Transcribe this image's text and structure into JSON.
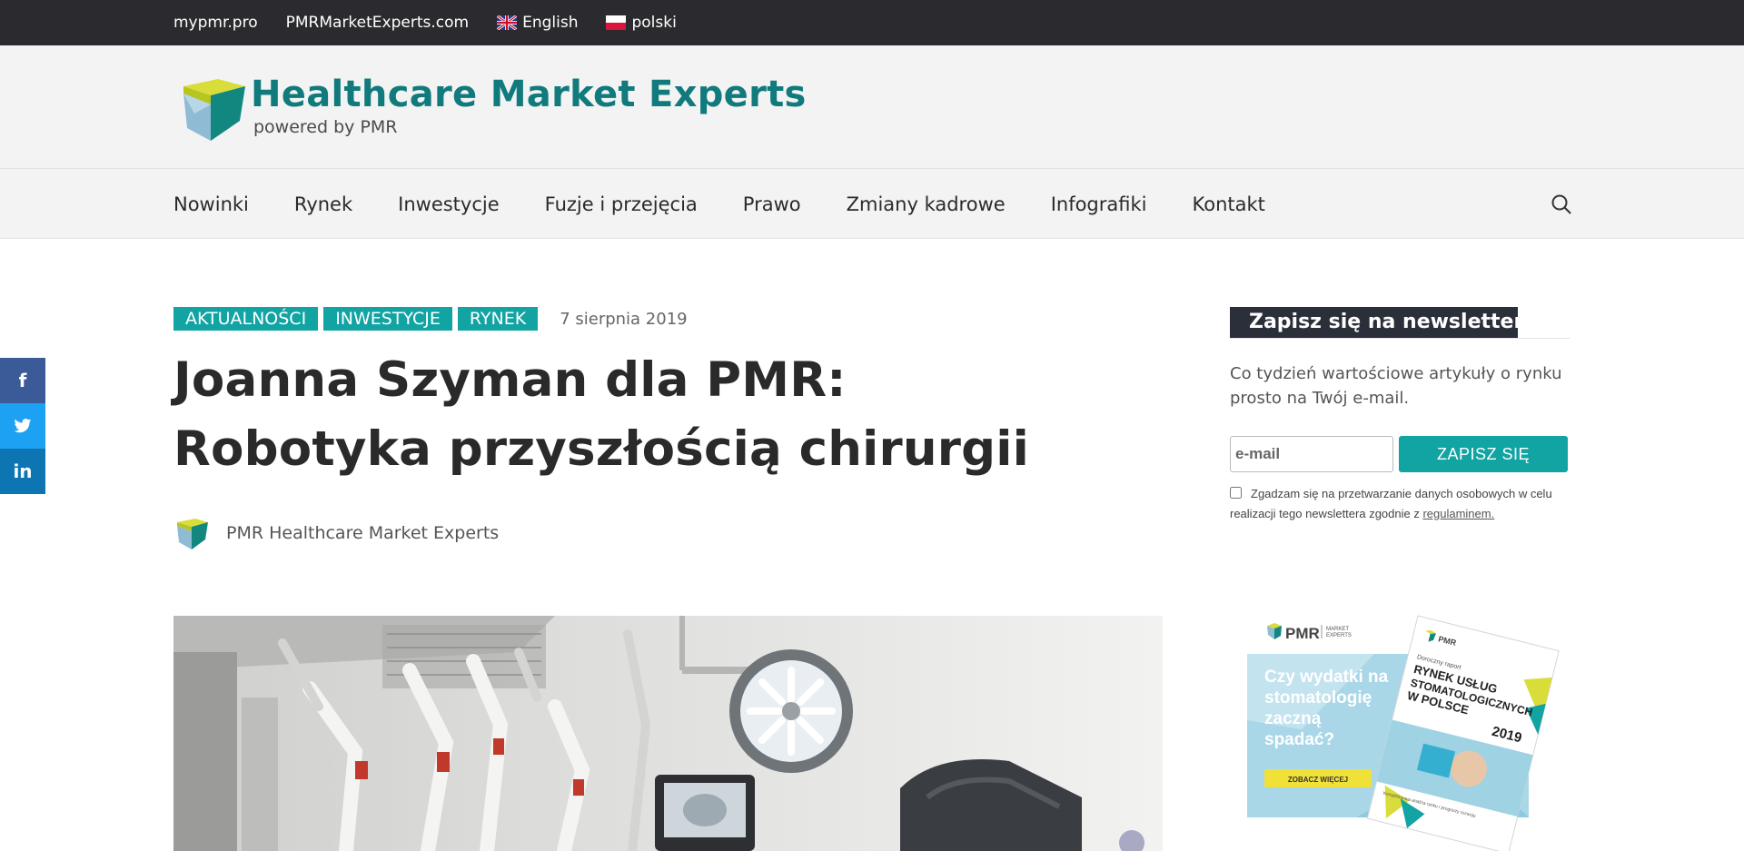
{
  "topbar": {
    "links": [
      {
        "label": "mypmr.pro"
      },
      {
        "label": "PMRMarketExperts.com"
      },
      {
        "label": "English",
        "flag": "uk-flag-icon"
      },
      {
        "label": "polski",
        "flag": "poland-flag-icon"
      }
    ]
  },
  "header": {
    "logo_title": "Healthcare Market Experts",
    "logo_subtitle": "powered by PMR"
  },
  "nav": {
    "items": [
      "Nowinki",
      "Rynek",
      "Inwestycje",
      "Fuzje i przejęcia",
      "Prawo",
      "Zmiany kadrowe",
      "Infografiki",
      "Kontakt"
    ],
    "search_icon": "search-icon"
  },
  "social": {
    "facebook": "f",
    "twitter": "twitter-icon",
    "linkedin": "in"
  },
  "article": {
    "tags": [
      "AKTUALNOŚCI",
      "INWESTYCJE",
      "RYNEK"
    ],
    "date": "7 sierpnia 2019",
    "title": "Joanna Szyman dla PMR: Robotyka przyszłością chirurgii",
    "author": "PMR Healthcare Market Experts"
  },
  "sidebar": {
    "newsletter_heading": "Zapisz się na newsletter!",
    "newsletter_text": "Co tydzień wartościowe artykuły o rynku prosto na Twój e-mail.",
    "email_placeholder": "e-mail",
    "subscribe_label": "ZAPISZ SIĘ",
    "consent_text": "Zgadzam się na przetwarzanie danych osobowych w celu realizacji tego newslettera zgodnie z ",
    "consent_link": "regulaminem."
  },
  "ad": {
    "brand": "PMR",
    "brand_sub_1": "MARKET",
    "brand_sub_2": "EXPERTS",
    "headline_1": "Czy wydatki na",
    "headline_2": "stomatologię",
    "headline_3": "zaczną",
    "headline_4": "spadać?",
    "cta": "ZOBACZ WIĘCEJ",
    "report_kicker": "Doroczny raport",
    "report_1": "RYNEK USŁUG",
    "report_2": "STOMATOLOGICZNYCH",
    "report_3": "W POLSCE",
    "report_year": "2019",
    "report_note": "Kompleksowa analiza rynku i prognozy rozwoju"
  },
  "colors": {
    "teal": "#12a3a3",
    "logo_teal": "#107a7c",
    "topbar": "#2b2b2f",
    "newsletter_heading_bg": "#2b2f3a"
  }
}
